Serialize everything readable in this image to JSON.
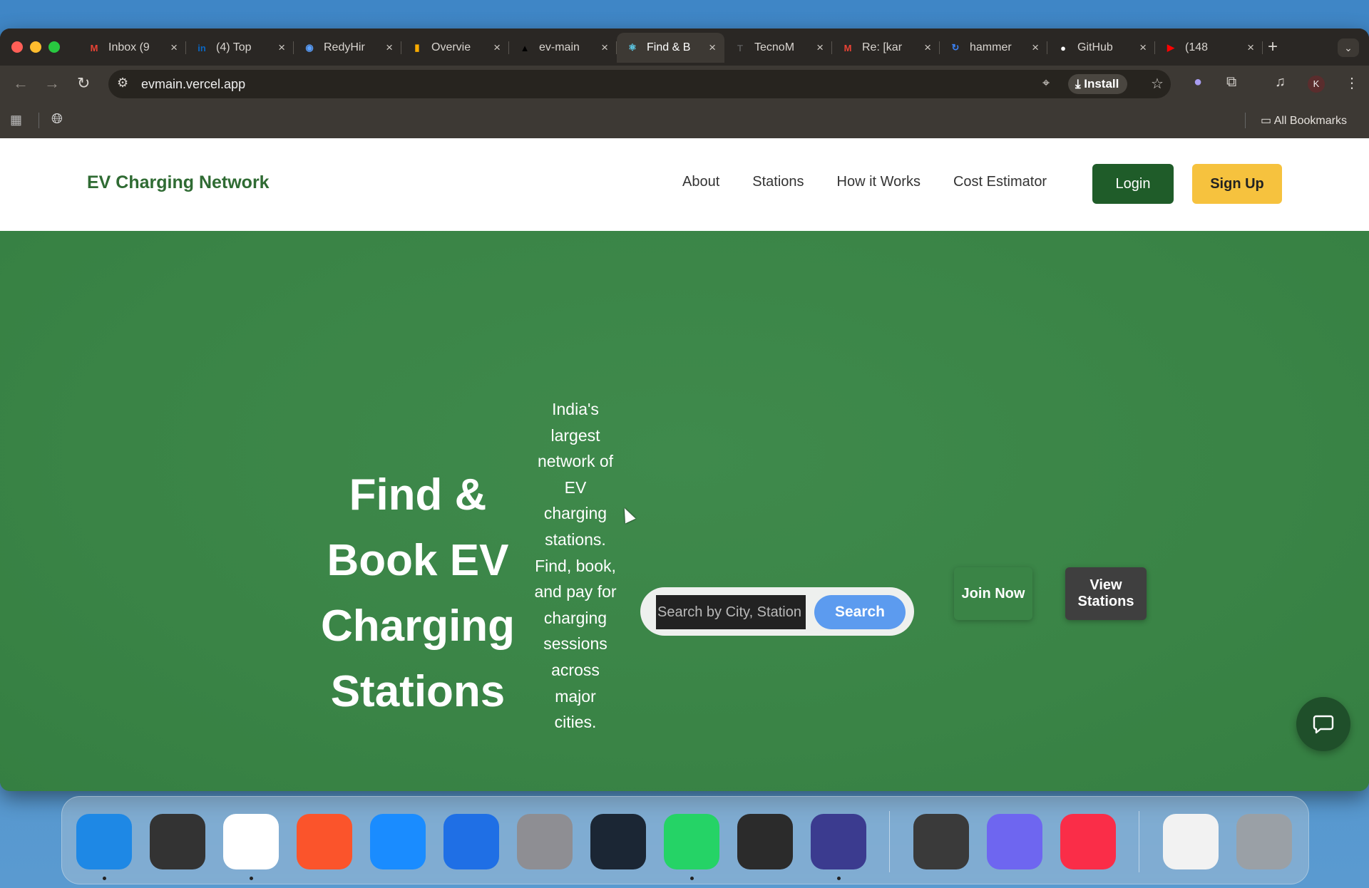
{
  "browser": {
    "tabs": [
      {
        "title": "Inbox (9",
        "favicon": "gmail-icon",
        "color": "#ea4335",
        "glyph": "M",
        "active": false
      },
      {
        "title": "(4) Top",
        "favicon": "linkedin-icon",
        "color": "#0a66c2",
        "glyph": "in",
        "active": false
      },
      {
        "title": "RedyHir",
        "favicon": "redyhire-icon",
        "color": "#5aa0ff",
        "glyph": "◉",
        "active": false
      },
      {
        "title": "Overvie",
        "favicon": "analytics-icon",
        "color": "#f9ab00",
        "glyph": "▮",
        "active": false
      },
      {
        "title": "ev-main",
        "favicon": "vercel-icon",
        "color": "#000000",
        "glyph": "▲",
        "active": false
      },
      {
        "title": "Find & B",
        "favicon": "react-icon",
        "color": "#61dafb",
        "glyph": "⚛",
        "active": true
      },
      {
        "title": "TecnoM",
        "favicon": "tecnom-icon",
        "color": "#555555",
        "glyph": "T",
        "active": false
      },
      {
        "title": "Re: [kar",
        "favicon": "gmail-icon",
        "color": "#ea4335",
        "glyph": "M",
        "active": false
      },
      {
        "title": "hammer",
        "favicon": "hammer-icon",
        "color": "#3b82f6",
        "glyph": "↻",
        "active": false
      },
      {
        "title": "GitHub",
        "favicon": "github-icon",
        "color": "#ffffff",
        "glyph": "●",
        "active": false
      },
      {
        "title": "(148",
        "favicon": "youtube-icon",
        "color": "#ff0000",
        "glyph": "▶",
        "active": false
      }
    ],
    "url": "evmain.vercel.app",
    "install_label": "Install",
    "avatar_letter": "K",
    "bookmarks_label": "All Bookmarks"
  },
  "site": {
    "brand": "EV Charging Network",
    "nav": [
      "About",
      "Stations",
      "How it Works",
      "Cost Estimator"
    ],
    "login_label": "Login",
    "signup_label": "Sign Up",
    "hero_title": "Find & Book EV Charging Stations",
    "hero_subtitle": "India's largest network of EV charging stations. Find, book, and pay for charging sessions across major cities.",
    "search_placeholder": "Search by City, Station",
    "search_label": "Search",
    "join_label": "Join Now",
    "view_label": "View Stations"
  },
  "colors": {
    "brand_green": "#2f6b33",
    "hero_green": "#3b8748",
    "login_bg": "#1f5c29",
    "signup_bg": "#f6c23e",
    "search_btn": "#5c9bef"
  },
  "dock": [
    {
      "name": "finder-icon",
      "color": "#1e88e5",
      "running": true
    },
    {
      "name": "launchpad-icon",
      "color": "#333333",
      "running": false
    },
    {
      "name": "chrome-icon",
      "color": "#ffffff",
      "running": true
    },
    {
      "name": "brave-icon",
      "color": "#fb542b",
      "running": false
    },
    {
      "name": "safari-icon",
      "color": "#1a8cff",
      "running": false
    },
    {
      "name": "app-store-icon",
      "color": "#1f6fe5",
      "running": false
    },
    {
      "name": "system-settings-icon",
      "color": "#8e8e93",
      "running": false
    },
    {
      "name": "vscode-icon",
      "color": "#1b2634",
      "running": false
    },
    {
      "name": "whatsapp-icon",
      "color": "#25d366",
      "running": true
    },
    {
      "name": "cube-app-icon",
      "color": "#2b2b2b",
      "running": false
    },
    {
      "name": "arc-browser-icon",
      "color": "#3b3b8f",
      "running": true
    },
    {
      "name": "trash-can-app-icon",
      "color": "#3a3a3a",
      "running": false
    },
    {
      "name": "terminal-ai-icon",
      "color": "#6e66f0",
      "running": false
    },
    {
      "name": "music-icon",
      "color": "#fa2d48",
      "running": false
    },
    {
      "name": "document-icon",
      "color": "#f2f2f2",
      "running": false
    },
    {
      "name": "trash-icon",
      "color": "#9aa0a6",
      "running": false
    }
  ]
}
